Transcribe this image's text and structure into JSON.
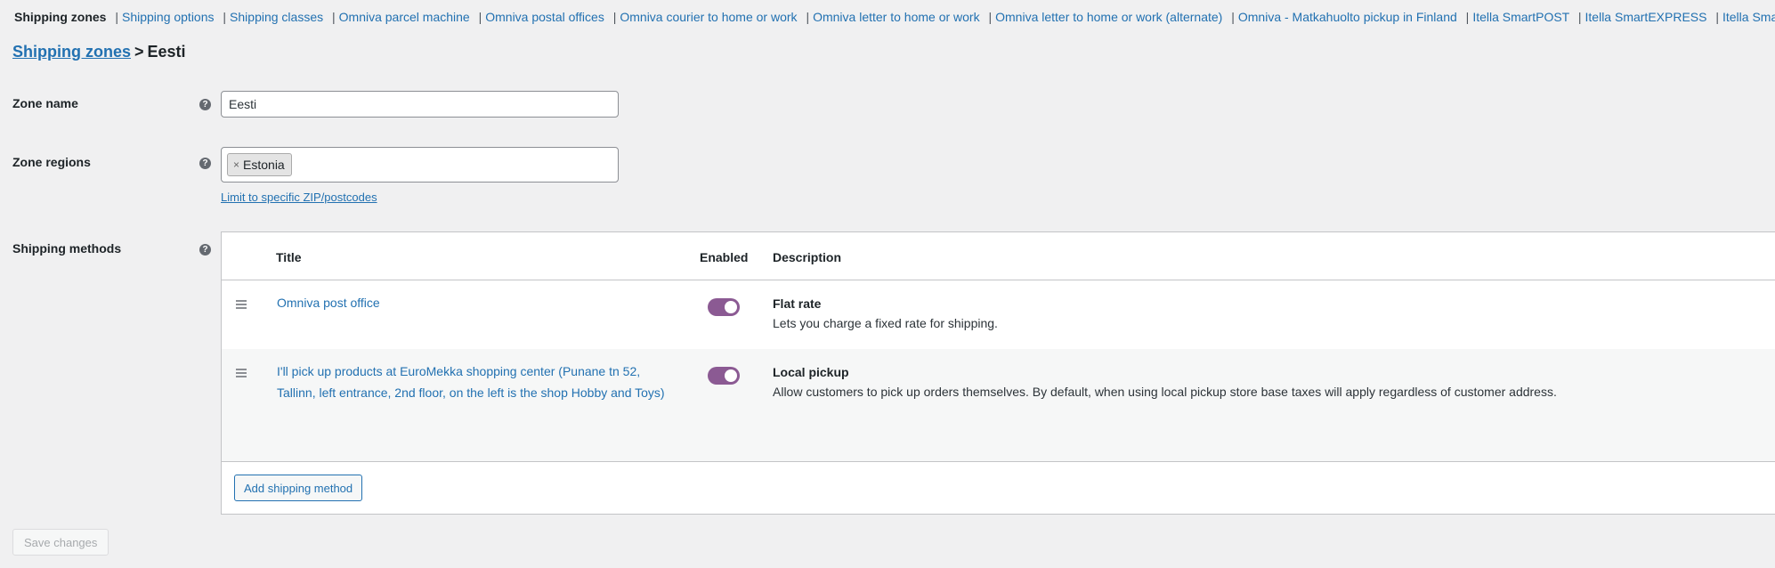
{
  "subnav": {
    "items": [
      {
        "label": "Shipping zones",
        "current": true
      },
      {
        "label": "Shipping options"
      },
      {
        "label": "Shipping classes"
      },
      {
        "label": "Omniva parcel machine"
      },
      {
        "label": "Omniva postal offices"
      },
      {
        "label": "Omniva courier to home or work"
      },
      {
        "label": "Omniva letter to home or work"
      },
      {
        "label": "Omniva letter to home or work (alternate)"
      },
      {
        "label": "Omniva - Matkahuolto pickup in Finland"
      },
      {
        "label": "Itella SmartPOST"
      },
      {
        "label": "Itella SmartEXPRESS"
      },
      {
        "label": "Itella SmartKULLER"
      }
    ],
    "separator": "|"
  },
  "breadcrumb": {
    "link": "Shipping zones",
    "separator": ">",
    "current": "Eesti"
  },
  "form": {
    "help_glyph": "?",
    "zone_name": {
      "label": "Zone name",
      "value": "Eesti"
    },
    "zone_regions": {
      "label": "Zone regions",
      "chips": [
        {
          "label": "Estonia",
          "remove": "×"
        }
      ],
      "limit_link": "Limit to specific ZIP/postcodes"
    },
    "shipping_methods": {
      "label": "Shipping methods",
      "columns": {
        "title": "Title",
        "enabled": "Enabled",
        "description": "Description"
      },
      "rows": [
        {
          "title": "Omniva post office",
          "enabled": true,
          "desc_title": "Flat rate",
          "desc": "Lets you charge a fixed rate for shipping."
        },
        {
          "title": "I'll pick up products at EuroMekka shopping center (Punane tn 52, Tallinn, left entrance, 2nd floor, on the left is the shop Hobby and Toys)",
          "enabled": true,
          "desc_title": "Local pickup",
          "desc": "Allow customers to pick up orders themselves. By default, when using local pickup store base taxes will apply regardless of customer address."
        }
      ],
      "add_button": "Add shipping method"
    }
  },
  "save_button": "Save changes",
  "colors": {
    "link": "#2271b1",
    "toggle_on": "#8b5a93",
    "background": "#f0f0f1"
  }
}
